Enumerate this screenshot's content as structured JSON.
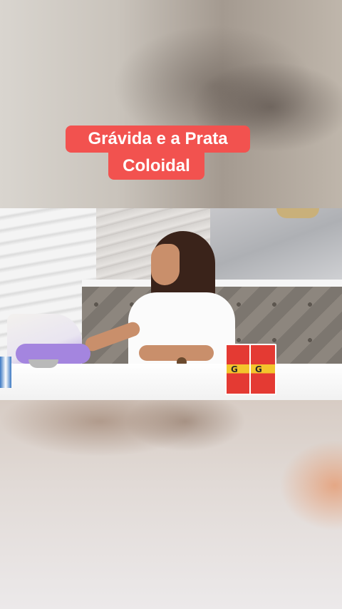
{
  "caption": {
    "line1": "Grávida e a Prata",
    "line2": "Coloidal"
  },
  "colors": {
    "caption_background": "#f2524f",
    "caption_text": "#ffffff"
  },
  "product_boxes": [
    {
      "letter": "G"
    },
    {
      "letter": "G"
    }
  ]
}
